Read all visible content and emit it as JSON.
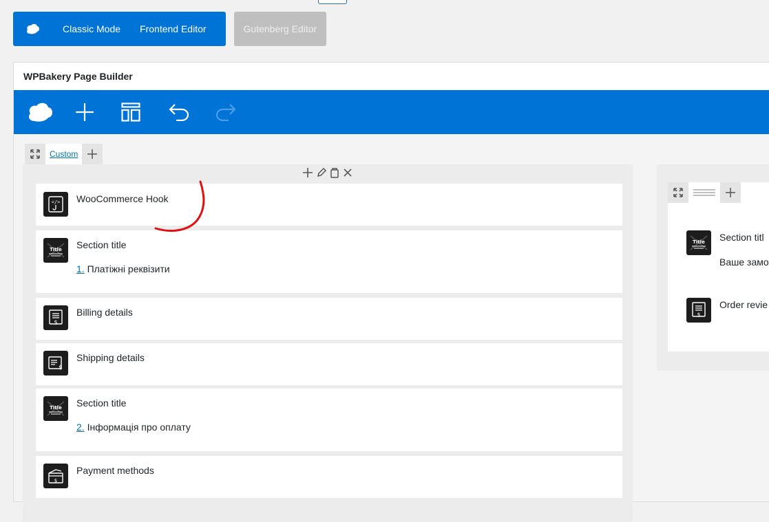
{
  "mode_bar": {
    "classic_mode": "Classic Mode",
    "frontend_editor": "Frontend Editor",
    "gutenberg_editor": "Gutenberg Editor"
  },
  "builder": {
    "title": "WPBakery Page Builder"
  },
  "toolbar": {
    "icons": [
      "wpbakery-logo-icon",
      "add-element-icon",
      "templates-icon",
      "undo-icon",
      "redo-icon"
    ]
  },
  "row": {
    "custom_label": "Custom"
  },
  "left_column": {
    "elements": [
      {
        "title": "WooCommerce Hook",
        "icon": "hook-code-icon"
      },
      {
        "title": "Section title",
        "icon": "title-icon",
        "sub_num": "1.",
        "sub_text": " Платіжні реквізити"
      },
      {
        "title": "Billing details",
        "icon": "billing-receipt-icon"
      },
      {
        "title": "Shipping details",
        "icon": "shipping-receipt-icon"
      },
      {
        "title": "Section title",
        "icon": "title-icon",
        "sub_num": "2.",
        "sub_text": " Інформація про оплату"
      },
      {
        "title": "Payment methods",
        "icon": "payment-methods-icon"
      }
    ]
  },
  "right_column": {
    "elements": [
      {
        "title": "Section titl",
        "icon": "title-icon",
        "sub_text": "Ваше замо"
      },
      {
        "title": "Order revie",
        "icon": "order-review-icon"
      }
    ]
  },
  "colors": {
    "accent": "#0073d6",
    "gutenberg_bg": "#bfbfbf",
    "annotation": "#e01010"
  }
}
